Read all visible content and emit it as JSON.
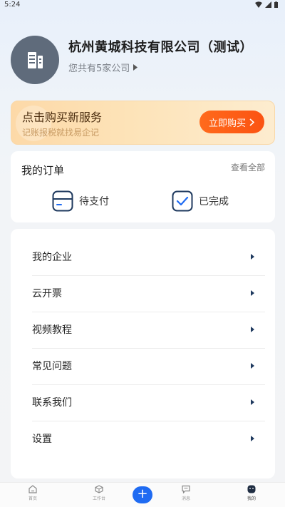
{
  "status": {
    "time": "5:24"
  },
  "profile": {
    "company_name": "杭州黄城科技有限公司（测试）",
    "company_count": "您共有5家公司"
  },
  "promo": {
    "title": "点击购买新服务",
    "subtitle": "记账报税就找易企记",
    "button": "立即购买"
  },
  "orders": {
    "title": "我的订单",
    "view_all": "查看全部",
    "items": [
      {
        "label": "待支付",
        "icon": "card-icon"
      },
      {
        "label": "已完成",
        "icon": "check-icon"
      }
    ]
  },
  "menu": {
    "items": [
      {
        "label": "我的企业"
      },
      {
        "label": "云开票"
      },
      {
        "label": "视频教程"
      },
      {
        "label": "常见问题"
      },
      {
        "label": "联系我们"
      },
      {
        "label": "设置"
      }
    ]
  },
  "tabbar": {
    "tabs": [
      {
        "label": "首页",
        "icon": "home-icon"
      },
      {
        "label": "工作台",
        "icon": "workbench-icon"
      },
      {
        "label": "+",
        "icon": "plus-icon"
      },
      {
        "label": "消息",
        "icon": "message-icon"
      },
      {
        "label": "我的",
        "icon": "profile-icon"
      }
    ]
  },
  "colors": {
    "accent": "#1f6bf2",
    "promo_button": "#fb5312",
    "avatar_bg": "#5f6b7b",
    "icon_dark": "#1f3a5f"
  }
}
